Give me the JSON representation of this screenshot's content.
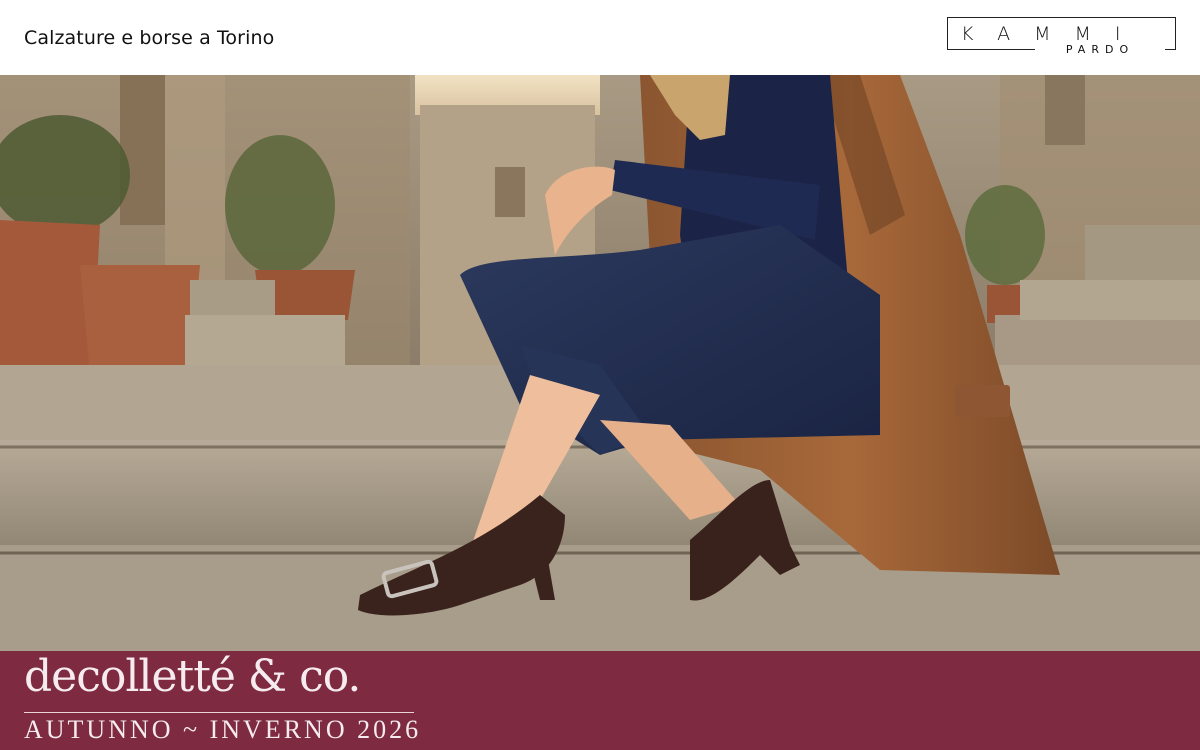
{
  "header": {
    "tagline": "Calzature e borse a Torino",
    "logo": {
      "brand": "KAMMI",
      "sub": "PARDO"
    }
  },
  "hero": {
    "photo_description_icon": "woman-seated-on-stone-steps-photo"
  },
  "banner": {
    "title": "decolletté & co.",
    "subtitle": "AUTUNNO ~ INVERNO 2026",
    "background": "#7e2a41"
  }
}
